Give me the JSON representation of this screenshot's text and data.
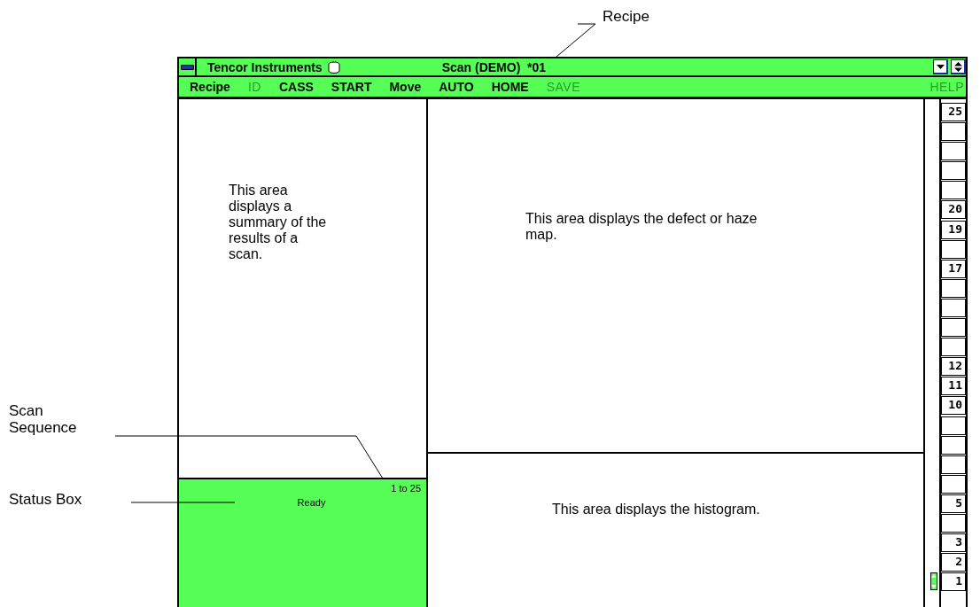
{
  "callouts": [
    {
      "kind": "recipe",
      "text": "Recipe"
    },
    {
      "kind": "sequence",
      "text": "Scan Sequence"
    },
    {
      "kind": "status",
      "text": "Status Box"
    }
  ],
  "window": {
    "app": "Tencor Instruments",
    "title": "Scan (DEMO)  *01"
  },
  "menu": [
    {
      "label": "Recipe",
      "disabled": false
    },
    {
      "label": "ID",
      "disabled": true
    },
    {
      "label": "CASS",
      "disabled": false
    },
    {
      "label": "START",
      "disabled": false
    },
    {
      "label": "Move",
      "disabled": false
    },
    {
      "label": "AUTO",
      "disabled": false
    },
    {
      "label": "HOME",
      "disabled": false
    },
    {
      "label": "SAVE",
      "disabled": true
    },
    {
      "label": "HELP",
      "disabled": true
    }
  ],
  "summary": {
    "text": "This area displays a summary of the results of a scan."
  },
  "status_box": {
    "sequence": "1 to 25",
    "status": "Ready"
  },
  "map": {
    "text": "This area displays the defect or haze map."
  },
  "histogram": {
    "text": "This area displays the histogram."
  },
  "slots": [
    {
      "label": "25",
      "selected": false
    },
    {
      "selected": false
    },
    {
      "selected": false
    },
    {
      "selected": false
    },
    {
      "selected": false
    },
    {
      "label": "20",
      "selected": false
    },
    {
      "label": "19",
      "selected": false
    },
    {
      "selected": false
    },
    {
      "label": "17",
      "selected": false
    },
    {
      "selected": false
    },
    {
      "selected": false
    },
    {
      "selected": false
    },
    {
      "selected": false
    },
    {
      "label": "12",
      "selected": false
    },
    {
      "label": "11",
      "selected": false
    },
    {
      "label": "10",
      "selected": false
    },
    {
      "selected": false
    },
    {
      "selected": false
    },
    {
      "selected": false
    },
    {
      "selected": false
    },
    {
      "label": "5",
      "selected": false
    },
    {
      "selected": false
    },
    {
      "label": "3",
      "selected": false
    },
    {
      "label": "2",
      "selected": false
    },
    {
      "label": "1",
      "selected": true
    }
  ]
}
